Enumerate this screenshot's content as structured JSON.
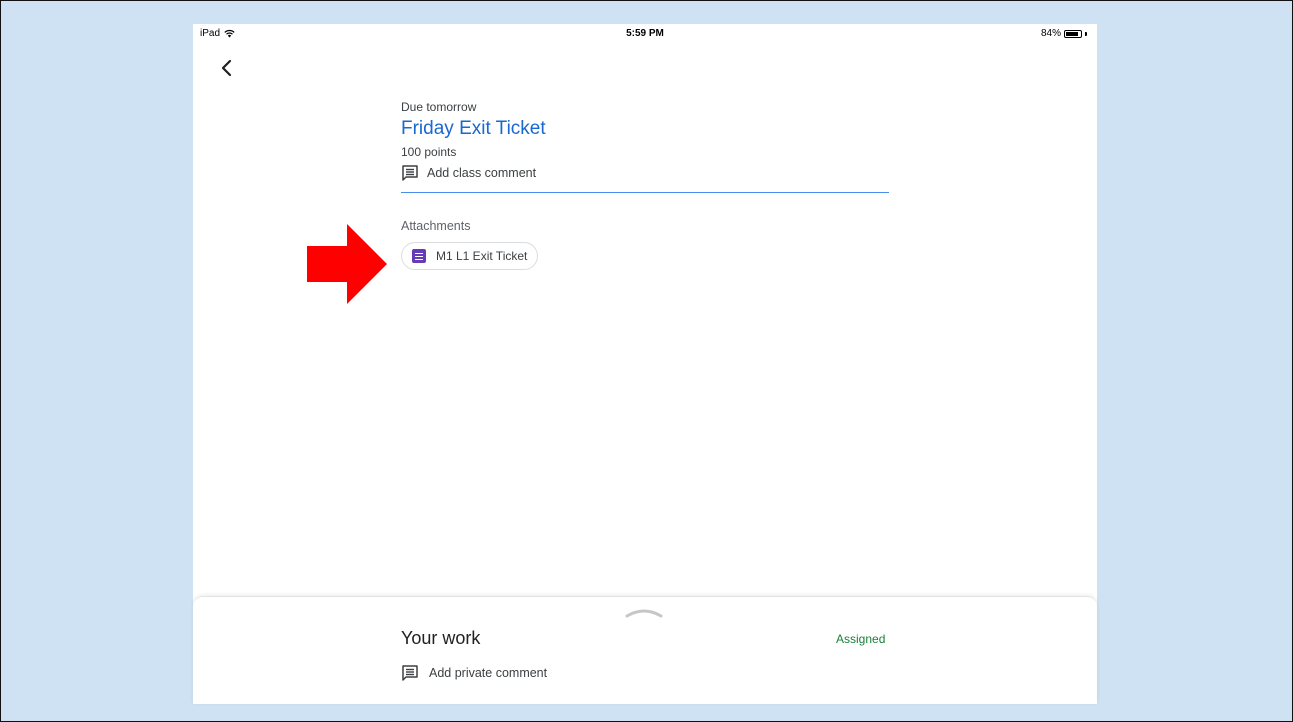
{
  "status_bar": {
    "device": "iPad",
    "time": "5:59 PM",
    "battery": "84%",
    "battery_level": 0.84
  },
  "assignment": {
    "due": "Due tomorrow",
    "title": "Friday Exit Ticket",
    "points": "100 points",
    "class_comment": "Add class comment"
  },
  "attachments": {
    "label": "Attachments",
    "items": [
      {
        "name": "M1 L1 Exit Ticket",
        "icon": "google-forms-icon"
      }
    ]
  },
  "your_work": {
    "title": "Your work",
    "status": "Assigned",
    "private_comment": "Add private comment"
  },
  "colors": {
    "title_blue": "#1967d2",
    "assigned_green": "#188038",
    "forms_purple": "#673ab7",
    "arrow_red": "#ff0000",
    "background": "#cfe2f3"
  },
  "icons": [
    "wifi-icon",
    "battery-icon",
    "back-arrow-icon",
    "comment-icon",
    "google-forms-icon",
    "red-arrow-icon",
    "chevron-up-icon"
  ]
}
